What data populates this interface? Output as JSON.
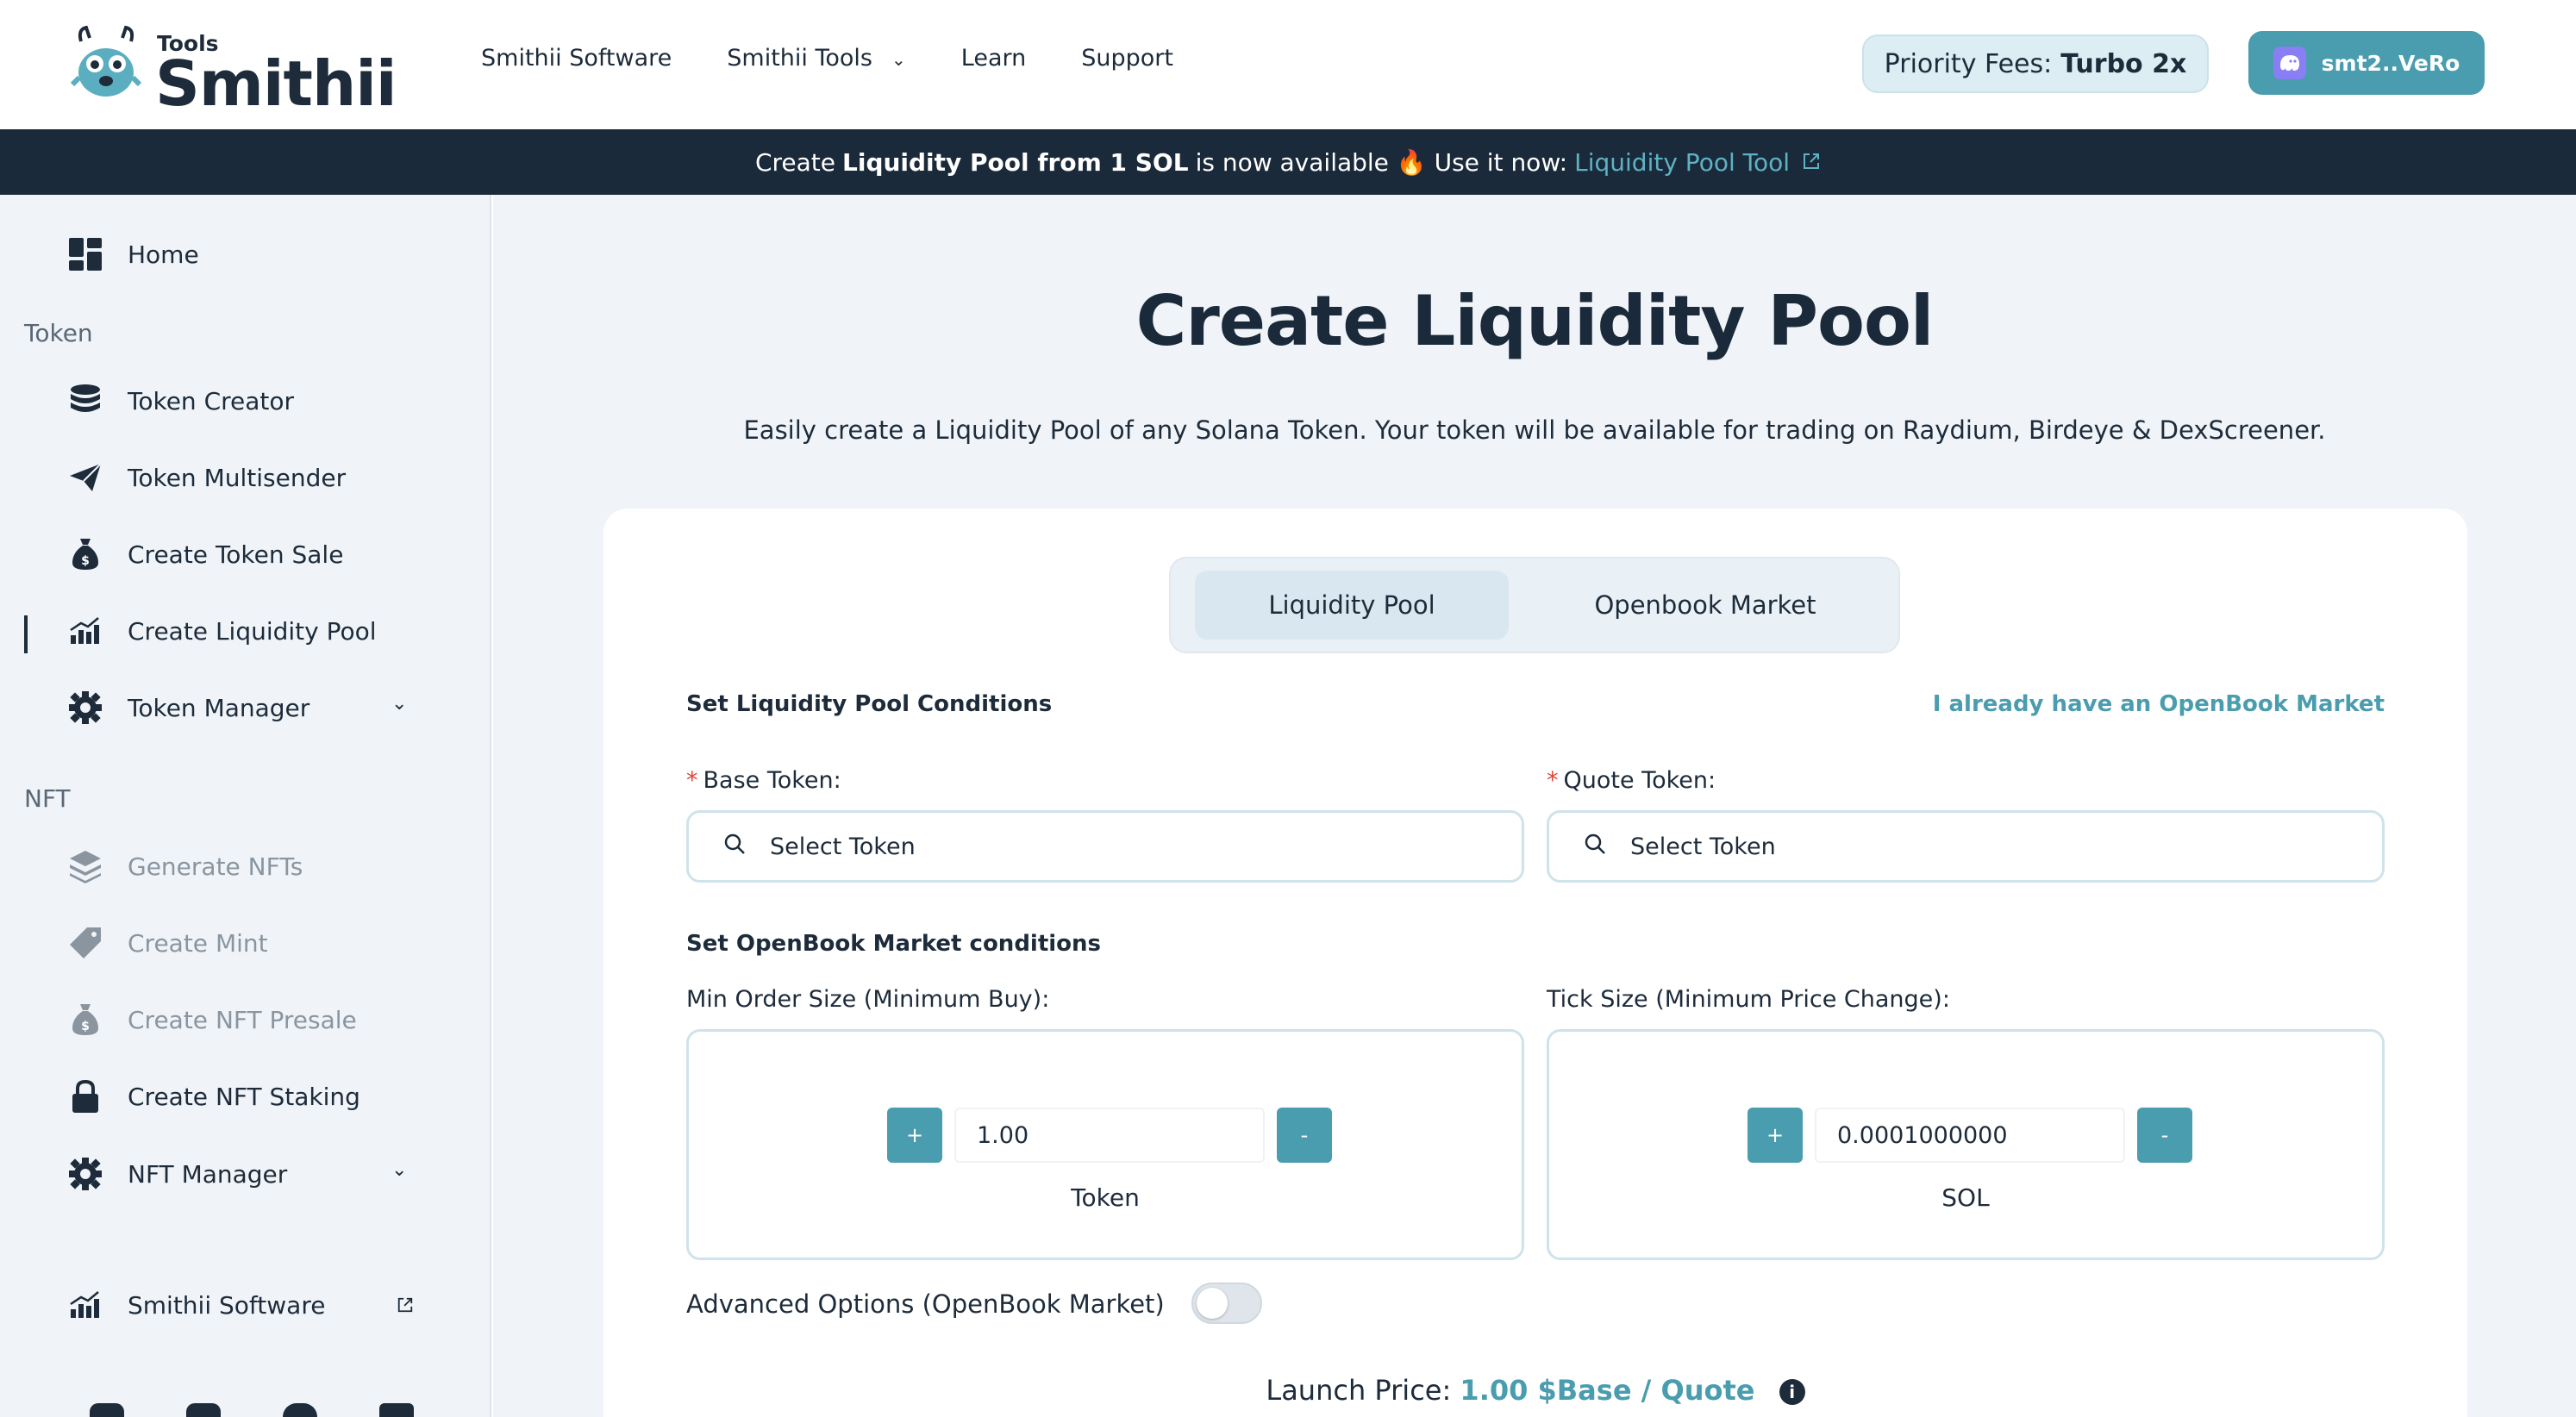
{
  "header": {
    "logo_small": "Tools",
    "logo_name": "Smithii",
    "nav": [
      {
        "label": "Smithii Software"
      },
      {
        "label": "Smithii Tools"
      },
      {
        "label": "Learn"
      },
      {
        "label": "Support"
      }
    ],
    "priority_fees_label": "Priority Fees:",
    "priority_fees_value": "Turbo 2x",
    "wallet_label": "smt2..VeRo"
  },
  "banner": {
    "text_1": "Create",
    "bold": "Liquidity Pool from 1 SOL",
    "text_2": "is now available 🔥 Use it now:",
    "link": "Liquidity Pool Tool"
  },
  "sidebar": {
    "home": "Home",
    "token_section": "Token",
    "token_items": [
      "Token Creator",
      "Token Multisender",
      "Create Token Sale",
      "Create Liquidity Pool",
      "Token Manager"
    ],
    "nft_section": "NFT",
    "nft_items": [
      "Generate NFTs",
      "Create Mint",
      "Create NFT Presale",
      "Create NFT Staking",
      "NFT Manager"
    ],
    "software": "Smithii Software"
  },
  "main": {
    "title": "Create Liquidity Pool",
    "description": "Easily create a Liquidity Pool of any Solana Token. Your token will be available for trading on Raydium, Birdeye & DexScreener.",
    "tabs": [
      "Liquidity Pool",
      "Openbook Market"
    ],
    "pool_conditions": "Set Liquidity Pool Conditions",
    "have_market_link": "I already have an OpenBook Market",
    "base_label": "Base Token:",
    "quote_label": "Quote Token:",
    "select_placeholder": "Select Token",
    "market_conditions": "Set OpenBook Market conditions",
    "min_order_label": "Min Order Size (Minimum Buy):",
    "tick_label": "Tick Size (Minimum Price Change):",
    "min_order_value": "1.00",
    "min_order_unit": "Token",
    "tick_value": "0.0001000000",
    "tick_unit": "SOL",
    "plus": "+",
    "minus": "-",
    "advanced_label": "Advanced Options (OpenBook Market)",
    "advanced_enabled": false,
    "launch_label": "Launch Price:",
    "launch_value": "1.00 $Base / Quote"
  }
}
